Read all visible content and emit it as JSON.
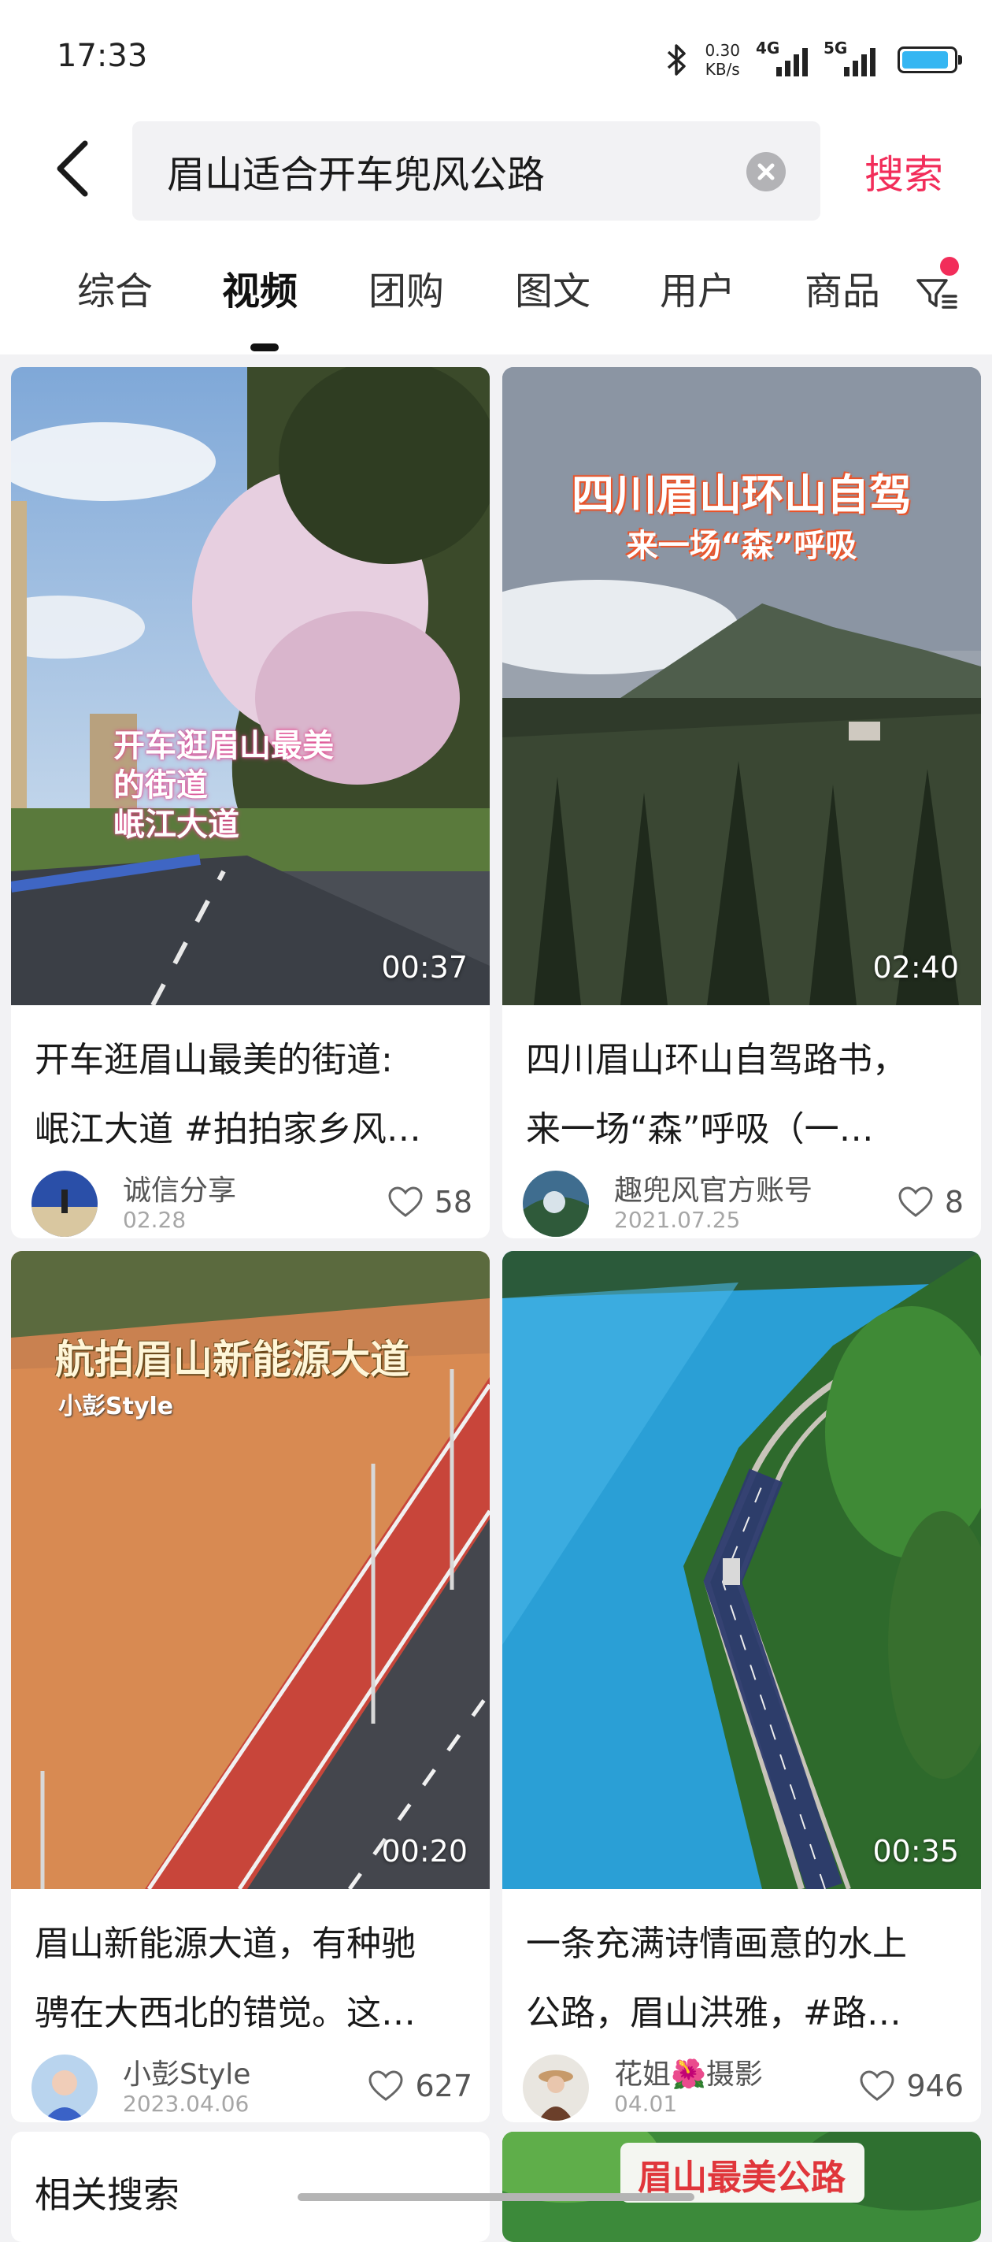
{
  "status_bar": {
    "time": "17:33",
    "net_speed_value": "0.30",
    "net_speed_unit": "KB/s",
    "signal_1_label": "4G",
    "signal_2_label": "5G",
    "battery_level": 0.9
  },
  "search": {
    "query": "眉山适合开车兜风公路",
    "submit_label": "搜索"
  },
  "tabs": [
    {
      "label": "综合"
    },
    {
      "label": "视频",
      "active": true
    },
    {
      "label": "团购"
    },
    {
      "label": "图文"
    },
    {
      "label": "用户"
    },
    {
      "label": "商品"
    }
  ],
  "results": [
    {
      "duration": "00:37",
      "overlay_text_1": "开车逛眉山最美",
      "overlay_text_2": "的街道",
      "overlay_text_3": "岷江大道",
      "title_line1": "开车逛眉山最美的街道:",
      "title_line2": "岷江大道 #拍拍家乡风…",
      "author": "诚信分享",
      "date": "02.28",
      "likes": "58"
    },
    {
      "duration": "02:40",
      "overlay_text_1": "四川眉山环山自驾",
      "overlay_text_2": "来一场“森”呼吸",
      "title_line1": "四川眉山环山自驾路书，",
      "title_line2": "来一场“森”呼吸（一…",
      "author": "趣兜风官方账号",
      "date": "2021.07.25",
      "likes": "8"
    },
    {
      "duration": "00:20",
      "overlay_text_1": "航拍眉山新能源大道",
      "overlay_text_2": "小彭Style",
      "title_line1": "眉山新能源大道，有种驰",
      "title_line2": "骋在大西北的错觉。这…",
      "author": "小彭Style",
      "date": "2023.04.06",
      "likes": "627"
    },
    {
      "duration": "00:35",
      "title_line1": "一条充满诗情画意的水上",
      "title_line2": "公路，眉山洪雅，#路…",
      "author": "花姐🌺摄影",
      "date": "04.01",
      "likes": "946"
    }
  ],
  "related": {
    "title": "相关搜索"
  },
  "peek": {
    "overlay_text": "眉山最美公路"
  }
}
